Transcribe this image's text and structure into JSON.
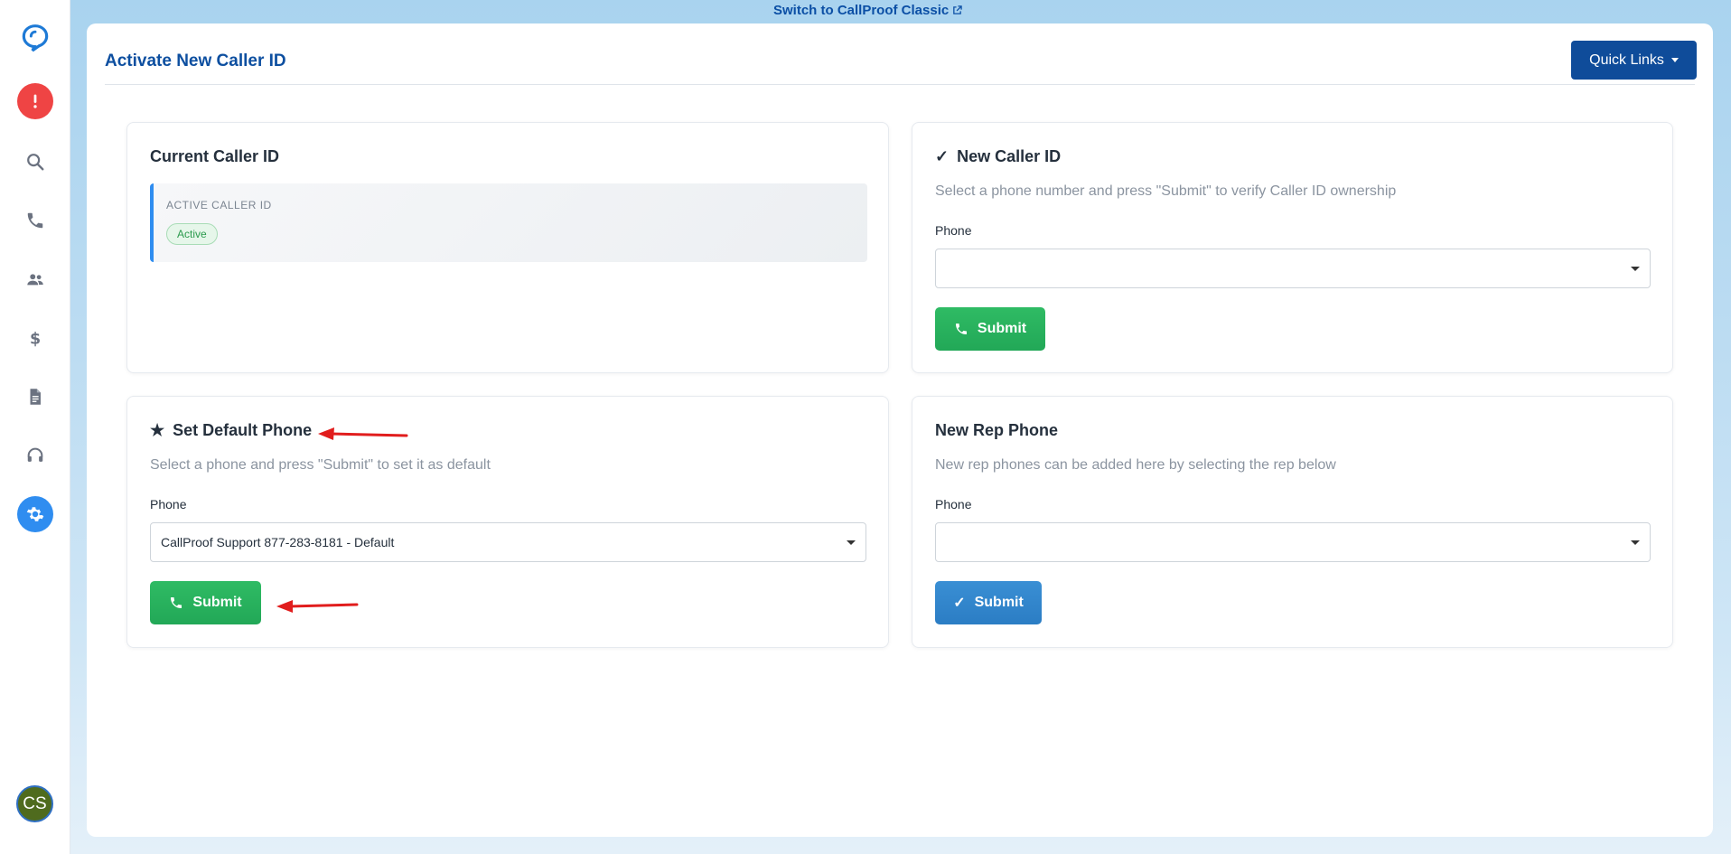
{
  "banner": {
    "switch_label": "Switch to CallProof Classic",
    "switch_icon": "external-link-icon"
  },
  "sidebar": {
    "logo_icon": "chat-bubble-logo-icon",
    "items": [
      {
        "name": "alerts",
        "icon": "exclamation-icon",
        "color": "#ef4444"
      },
      {
        "name": "search",
        "icon": "search-icon"
      },
      {
        "name": "calls",
        "icon": "phone-icon"
      },
      {
        "name": "contacts",
        "icon": "people-icon"
      },
      {
        "name": "sales",
        "icon": "dollar-icon"
      },
      {
        "name": "reports",
        "icon": "document-icon"
      },
      {
        "name": "support",
        "icon": "headset-icon"
      },
      {
        "name": "settings",
        "icon": "gear-icon",
        "active": true,
        "color": "#2f8df0"
      }
    ],
    "avatar_initials": "CS"
  },
  "header": {
    "title": "Activate New Caller ID",
    "quick_links_label": "Quick Links"
  },
  "current_caller_id": {
    "title": "Current Caller ID",
    "box_label": "ACTIVE CALLER ID",
    "status": "Active"
  },
  "new_caller_id": {
    "check": "✓",
    "title": "New Caller ID",
    "description": "Select a phone number and press \"Submit\" to verify Caller ID ownership",
    "phone_label": "Phone",
    "phone_value": "",
    "submit_label": "Submit"
  },
  "set_default_phone": {
    "star": "★",
    "title": "Set Default Phone",
    "description": "Select a phone and press \"Submit\" to set it as default",
    "phone_label": "Phone",
    "phone_value": "CallProof Support 877-283-8181 - Default",
    "submit_label": "Submit"
  },
  "new_rep_phone": {
    "title": "New Rep Phone",
    "description": "New rep phones can be added here by selecting the rep below",
    "phone_label": "Phone",
    "phone_value": "",
    "check": "✓",
    "submit_label": "Submit"
  },
  "colors": {
    "brand_blue": "#0f4c9a",
    "title_blue": "#0d4fa0",
    "success_green": "#22a857",
    "info_blue": "#2b7dc4",
    "annotation_red": "#e11d1d"
  }
}
